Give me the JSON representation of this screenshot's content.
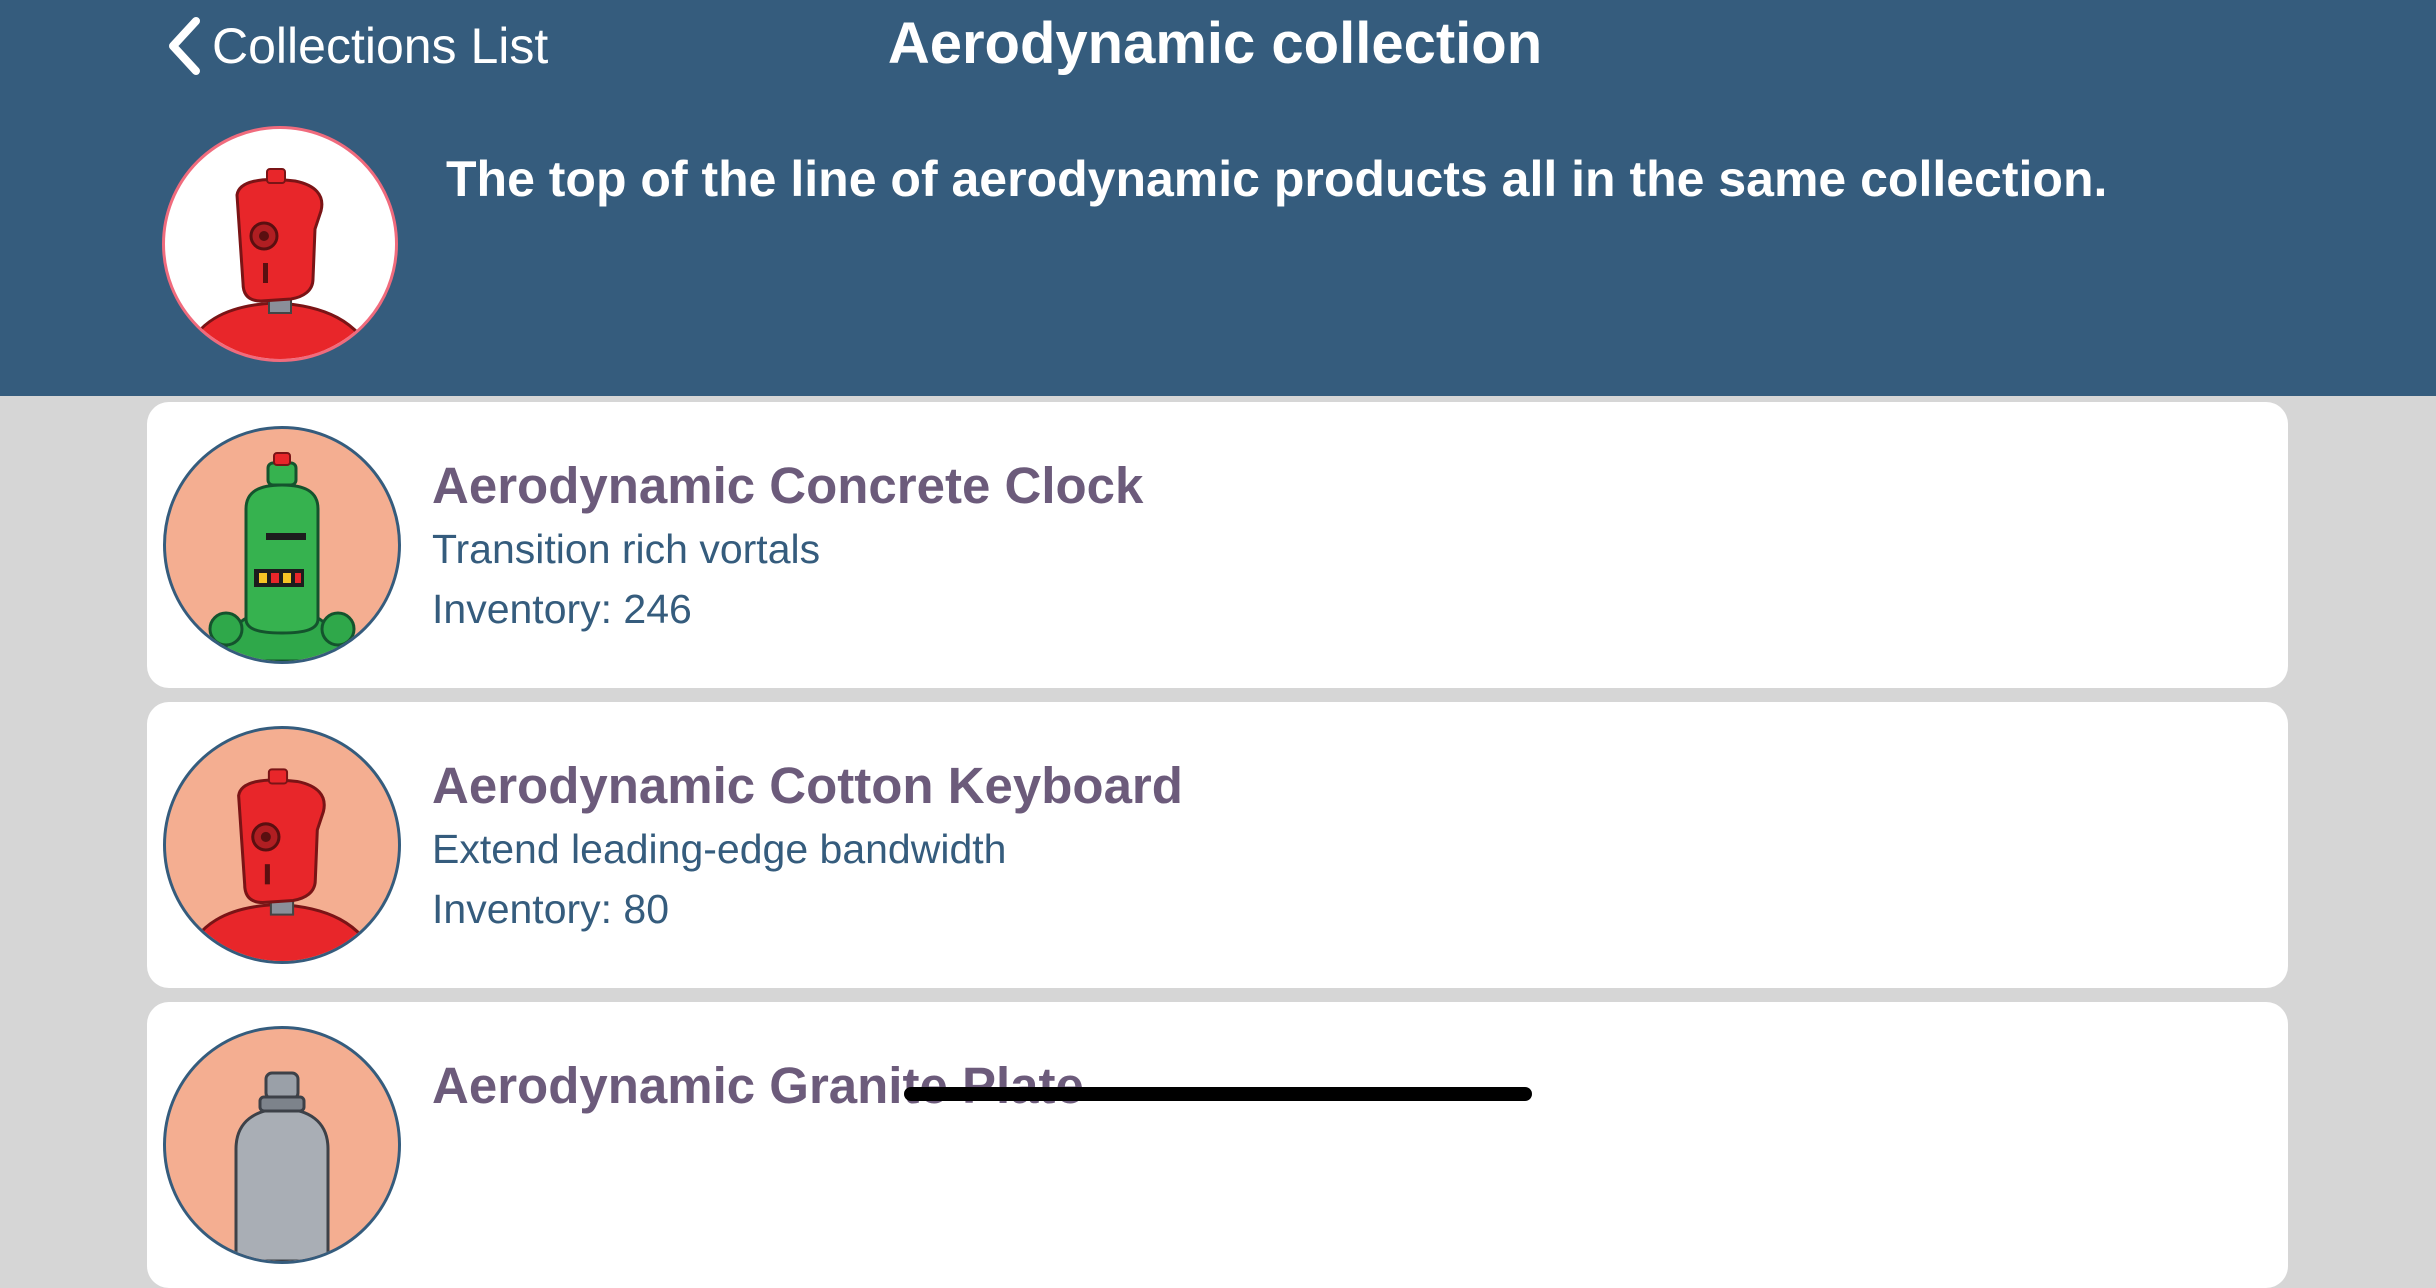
{
  "nav": {
    "back_label": "Collections List",
    "title": "Aerodynamic collection"
  },
  "collection": {
    "description": "The top of the line of aerodynamic products all in the same collection.",
    "avatar_icon": "red-robot"
  },
  "colors": {
    "header_bg": "#355c7d",
    "page_bg": "#d6d6d6",
    "item_name": "#6c5b7b",
    "item_text": "#355c7d",
    "avatar_bg": "#f4ae91",
    "collection_avatar_border": "#f06b7d"
  },
  "products": [
    {
      "name": "Aerodynamic Concrete Clock",
      "description": "Transition rich vortals",
      "inventory": "Inventory: 246",
      "icon": "green-robot"
    },
    {
      "name": "Aerodynamic Cotton Keyboard",
      "description": "Extend leading-edge bandwidth",
      "inventory": "Inventory: 80",
      "icon": "red-robot"
    },
    {
      "name": "Aerodynamic Granite Plate",
      "icon": "grey-robot"
    }
  ]
}
